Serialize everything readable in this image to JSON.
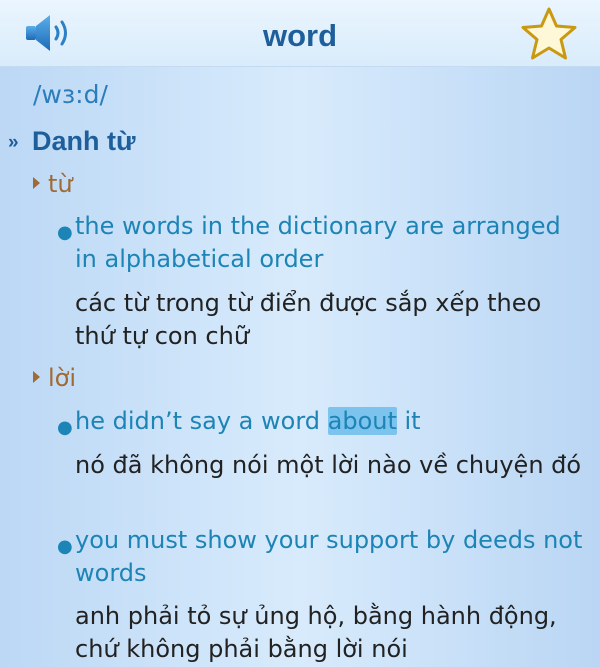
{
  "header": {
    "title": "word",
    "speaker_icon": "speaker-icon",
    "star_icon": "star-outline-icon"
  },
  "entry": {
    "pronunciation": "/wɜ:d/",
    "part_of_speech": "Danh từ",
    "senses": [
      {
        "label": "từ",
        "examples": [
          {
            "en": "the words in the dictionary are arranged in alphabetical order",
            "vi": "các từ trong từ điển được sắp xếp theo thứ tự con chữ"
          }
        ]
      },
      {
        "label": "lời",
        "examples": [
          {
            "en_before": "he didn’t say a word ",
            "en_highlight": "about",
            "en_after": " it",
            "vi": "nó đã không nói một lời nào về chuyện đó"
          },
          {
            "en": "you must show your support by deeds not words",
            "vi": "anh phải tỏ sự ủng hộ, bằng hành động, chứ không phải bằng lời nói"
          }
        ]
      }
    ]
  },
  "colors": {
    "title": "#1e5f9b",
    "example": "#1d84b6",
    "sense": "#a06a35",
    "highlight": "#7cc3ed",
    "star_stroke": "#c99912"
  }
}
